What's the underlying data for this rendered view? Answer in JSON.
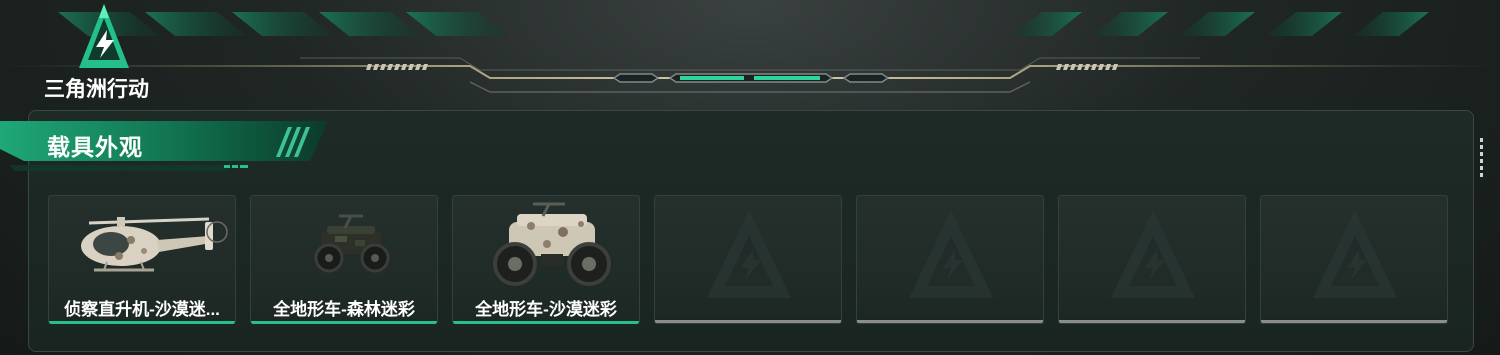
{
  "app": {
    "logo_text": "三角洲行动",
    "logo_icon": "triangle-lightning-logo"
  },
  "section": {
    "title": "载具外观"
  },
  "colors": {
    "accent": "#28c08a",
    "empty_bar": "#8a8f8d",
    "background": "#171c1a"
  },
  "items": [
    {
      "name": "侦察直升机-沙漠迷...",
      "icon": "helicopter-desert-camo",
      "selected": true
    },
    {
      "name": "全地形车-森林迷彩",
      "icon": "atv-forest-camo",
      "selected": true
    },
    {
      "name": "全地形车-沙漠迷彩",
      "icon": "atv-desert-camo",
      "selected": true
    },
    {
      "name": "",
      "icon": "empty-slot-logo",
      "selected": false
    },
    {
      "name": "",
      "icon": "empty-slot-logo",
      "selected": false
    },
    {
      "name": "",
      "icon": "empty-slot-logo",
      "selected": false
    },
    {
      "name": "",
      "icon": "empty-slot-logo",
      "selected": false
    }
  ]
}
